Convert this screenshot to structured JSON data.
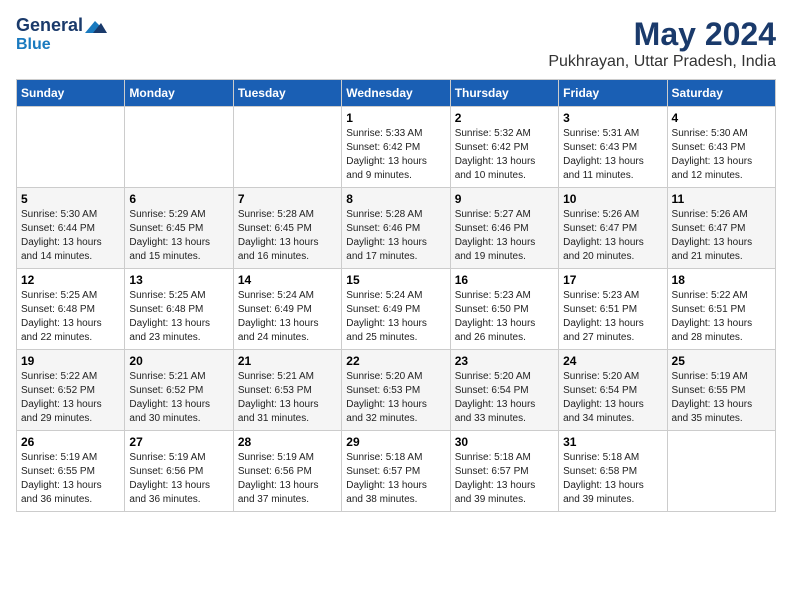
{
  "logo": {
    "line1": "General",
    "line2": "Blue"
  },
  "header": {
    "month": "May 2024",
    "location": "Pukhrayan, Uttar Pradesh, India"
  },
  "weekdays": [
    "Sunday",
    "Monday",
    "Tuesday",
    "Wednesday",
    "Thursday",
    "Friday",
    "Saturday"
  ],
  "weeks": [
    [
      {
        "day": "",
        "sunrise": "",
        "sunset": "",
        "daylight": ""
      },
      {
        "day": "",
        "sunrise": "",
        "sunset": "",
        "daylight": ""
      },
      {
        "day": "",
        "sunrise": "",
        "sunset": "",
        "daylight": ""
      },
      {
        "day": "1",
        "sunrise": "Sunrise: 5:33 AM",
        "sunset": "Sunset: 6:42 PM",
        "daylight": "Daylight: 13 hours and 9 minutes."
      },
      {
        "day": "2",
        "sunrise": "Sunrise: 5:32 AM",
        "sunset": "Sunset: 6:42 PM",
        "daylight": "Daylight: 13 hours and 10 minutes."
      },
      {
        "day": "3",
        "sunrise": "Sunrise: 5:31 AM",
        "sunset": "Sunset: 6:43 PM",
        "daylight": "Daylight: 13 hours and 11 minutes."
      },
      {
        "day": "4",
        "sunrise": "Sunrise: 5:30 AM",
        "sunset": "Sunset: 6:43 PM",
        "daylight": "Daylight: 13 hours and 12 minutes."
      }
    ],
    [
      {
        "day": "5",
        "sunrise": "Sunrise: 5:30 AM",
        "sunset": "Sunset: 6:44 PM",
        "daylight": "Daylight: 13 hours and 14 minutes."
      },
      {
        "day": "6",
        "sunrise": "Sunrise: 5:29 AM",
        "sunset": "Sunset: 6:45 PM",
        "daylight": "Daylight: 13 hours and 15 minutes."
      },
      {
        "day": "7",
        "sunrise": "Sunrise: 5:28 AM",
        "sunset": "Sunset: 6:45 PM",
        "daylight": "Daylight: 13 hours and 16 minutes."
      },
      {
        "day": "8",
        "sunrise": "Sunrise: 5:28 AM",
        "sunset": "Sunset: 6:46 PM",
        "daylight": "Daylight: 13 hours and 17 minutes."
      },
      {
        "day": "9",
        "sunrise": "Sunrise: 5:27 AM",
        "sunset": "Sunset: 6:46 PM",
        "daylight": "Daylight: 13 hours and 19 minutes."
      },
      {
        "day": "10",
        "sunrise": "Sunrise: 5:26 AM",
        "sunset": "Sunset: 6:47 PM",
        "daylight": "Daylight: 13 hours and 20 minutes."
      },
      {
        "day": "11",
        "sunrise": "Sunrise: 5:26 AM",
        "sunset": "Sunset: 6:47 PM",
        "daylight": "Daylight: 13 hours and 21 minutes."
      }
    ],
    [
      {
        "day": "12",
        "sunrise": "Sunrise: 5:25 AM",
        "sunset": "Sunset: 6:48 PM",
        "daylight": "Daylight: 13 hours and 22 minutes."
      },
      {
        "day": "13",
        "sunrise": "Sunrise: 5:25 AM",
        "sunset": "Sunset: 6:48 PM",
        "daylight": "Daylight: 13 hours and 23 minutes."
      },
      {
        "day": "14",
        "sunrise": "Sunrise: 5:24 AM",
        "sunset": "Sunset: 6:49 PM",
        "daylight": "Daylight: 13 hours and 24 minutes."
      },
      {
        "day": "15",
        "sunrise": "Sunrise: 5:24 AM",
        "sunset": "Sunset: 6:49 PM",
        "daylight": "Daylight: 13 hours and 25 minutes."
      },
      {
        "day": "16",
        "sunrise": "Sunrise: 5:23 AM",
        "sunset": "Sunset: 6:50 PM",
        "daylight": "Daylight: 13 hours and 26 minutes."
      },
      {
        "day": "17",
        "sunrise": "Sunrise: 5:23 AM",
        "sunset": "Sunset: 6:51 PM",
        "daylight": "Daylight: 13 hours and 27 minutes."
      },
      {
        "day": "18",
        "sunrise": "Sunrise: 5:22 AM",
        "sunset": "Sunset: 6:51 PM",
        "daylight": "Daylight: 13 hours and 28 minutes."
      }
    ],
    [
      {
        "day": "19",
        "sunrise": "Sunrise: 5:22 AM",
        "sunset": "Sunset: 6:52 PM",
        "daylight": "Daylight: 13 hours and 29 minutes."
      },
      {
        "day": "20",
        "sunrise": "Sunrise: 5:21 AM",
        "sunset": "Sunset: 6:52 PM",
        "daylight": "Daylight: 13 hours and 30 minutes."
      },
      {
        "day": "21",
        "sunrise": "Sunrise: 5:21 AM",
        "sunset": "Sunset: 6:53 PM",
        "daylight": "Daylight: 13 hours and 31 minutes."
      },
      {
        "day": "22",
        "sunrise": "Sunrise: 5:20 AM",
        "sunset": "Sunset: 6:53 PM",
        "daylight": "Daylight: 13 hours and 32 minutes."
      },
      {
        "day": "23",
        "sunrise": "Sunrise: 5:20 AM",
        "sunset": "Sunset: 6:54 PM",
        "daylight": "Daylight: 13 hours and 33 minutes."
      },
      {
        "day": "24",
        "sunrise": "Sunrise: 5:20 AM",
        "sunset": "Sunset: 6:54 PM",
        "daylight": "Daylight: 13 hours and 34 minutes."
      },
      {
        "day": "25",
        "sunrise": "Sunrise: 5:19 AM",
        "sunset": "Sunset: 6:55 PM",
        "daylight": "Daylight: 13 hours and 35 minutes."
      }
    ],
    [
      {
        "day": "26",
        "sunrise": "Sunrise: 5:19 AM",
        "sunset": "Sunset: 6:55 PM",
        "daylight": "Daylight: 13 hours and 36 minutes."
      },
      {
        "day": "27",
        "sunrise": "Sunrise: 5:19 AM",
        "sunset": "Sunset: 6:56 PM",
        "daylight": "Daylight: 13 hours and 36 minutes."
      },
      {
        "day": "28",
        "sunrise": "Sunrise: 5:19 AM",
        "sunset": "Sunset: 6:56 PM",
        "daylight": "Daylight: 13 hours and 37 minutes."
      },
      {
        "day": "29",
        "sunrise": "Sunrise: 5:18 AM",
        "sunset": "Sunset: 6:57 PM",
        "daylight": "Daylight: 13 hours and 38 minutes."
      },
      {
        "day": "30",
        "sunrise": "Sunrise: 5:18 AM",
        "sunset": "Sunset: 6:57 PM",
        "daylight": "Daylight: 13 hours and 39 minutes."
      },
      {
        "day": "31",
        "sunrise": "Sunrise: 5:18 AM",
        "sunset": "Sunset: 6:58 PM",
        "daylight": "Daylight: 13 hours and 39 minutes."
      },
      {
        "day": "",
        "sunrise": "",
        "sunset": "",
        "daylight": ""
      }
    ]
  ]
}
